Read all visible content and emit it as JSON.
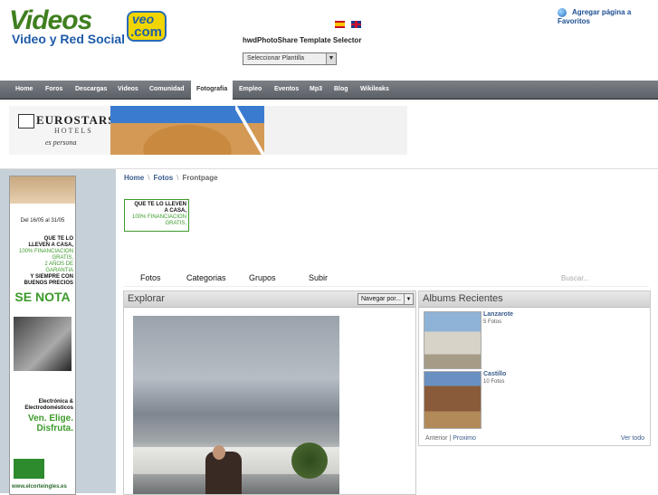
{
  "header": {
    "logo_main": "Videos",
    "logo_badge_top": "veo",
    "logo_badge_bottom": ".com",
    "logo_subtitle": "Video y Red Social",
    "favorites_link": "Agregar página a Favoritos",
    "template_title": "hwdPhotoShare Template Selector",
    "template_select_value": "Seleccionar Plantilla"
  },
  "nav": {
    "items": [
      "Home",
      "Foros",
      "Descargas",
      "Videos",
      "Comunidad",
      "Fotografia",
      "Empleo",
      "Eventos",
      "Mp3",
      "Blog",
      "Wikileaks"
    ],
    "active": "Fotografia"
  },
  "banner": {
    "brand": "EUROSTARS",
    "sub": "HOTELS",
    "tagline": "es persona"
  },
  "sidebar_ad": {
    "date": "Del 16/05 al 31/05",
    "line1": "QUE TE LO",
    "line2": "LLEVEN A CASA,",
    "line3": "100% FINANCIACION",
    "line4": "GRATIS,",
    "line5": "2 AÑOS DE",
    "line6": "GARANTIA",
    "line7": "Y SIEMPRE CON",
    "line8": "BUENOS PRECIOS",
    "big": "SE NOTA",
    "elec1": "Electrónica &",
    "elec2": "Electrodomésticos",
    "ven1": "Ven. Elige.",
    "ven2": "Disfruta.",
    "url": "www.elcorteingles.es"
  },
  "breadcrumb": {
    "items": [
      "Home",
      "Fotos",
      "Frontpage"
    ]
  },
  "mini_ad": {
    "l1": "QUE TE LO LLEVEN",
    "l2": "A CASA,",
    "l3": "100% FINANCIACION",
    "l4": "GRATIS,"
  },
  "tabs": {
    "fotos": "Fotos",
    "categorias": "Categorias",
    "grupos": "Grupos",
    "subir": "Subir",
    "search_placeholder": "Buscar..."
  },
  "explorar": {
    "title": "Explorar",
    "browse_select": "Navegar por..."
  },
  "albums": {
    "title": "Albums Recientes",
    "items": [
      {
        "name": "Lanzarote",
        "count": "5 Fotos"
      },
      {
        "name": "Castillo",
        "count": "10 Fotos"
      }
    ],
    "prev": "Anterior",
    "sep": " | ",
    "next": "Proximo",
    "view_all": "Ver todo"
  }
}
